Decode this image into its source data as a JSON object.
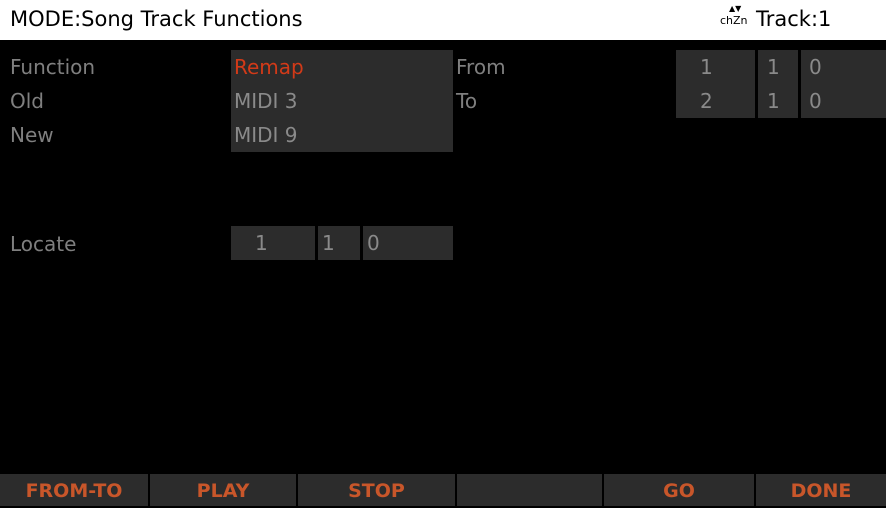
{
  "header": {
    "mode_title": "MODE:Song Track Functions",
    "chzn_label": "chZn",
    "chzn_arrows": "▲▼",
    "track_label": "Track:1"
  },
  "params": {
    "function": {
      "label": "Function",
      "value": "Remap"
    },
    "old": {
      "label": "Old",
      "value": "MIDI 3"
    },
    "new": {
      "label": "New",
      "value": "MIDI 9"
    },
    "from": {
      "label": "From",
      "bar": "1",
      "beat": "1",
      "tick": "0"
    },
    "to": {
      "label": "To",
      "bar": "2",
      "beat": "1",
      "tick": "0"
    },
    "locate": {
      "label": "Locate",
      "bar": "1",
      "beat": "1",
      "tick": "0"
    }
  },
  "softkeys": [
    "FROM-TO",
    "PLAY",
    "STOP",
    "",
    "GO",
    "DONE"
  ],
  "colors": {
    "accent": "#d23a18",
    "softkey_text": "#c8562a",
    "field_bg": "#2c2c2c",
    "label": "#7f7f7f"
  }
}
